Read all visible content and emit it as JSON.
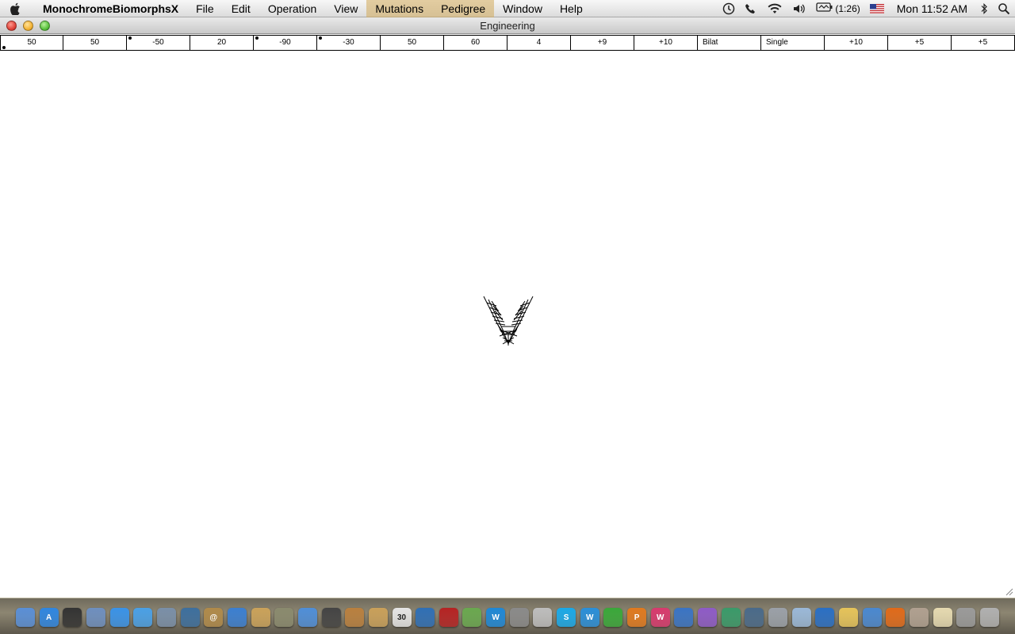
{
  "menubar": {
    "app_name": "MonochromeBiomorphsX",
    "menus": [
      "File",
      "Edit",
      "Operation",
      "View",
      "Mutations",
      "Pedigree",
      "Window",
      "Help"
    ],
    "battery": "(1:26)",
    "clock": "Mon 11:52 AM",
    "status_icons": [
      "time-machine-icon",
      "phone-icon",
      "wifi-icon",
      "volume-icon",
      "battery-icon",
      "us-flag-icon",
      "bluetooth-icon",
      "spotlight-icon"
    ]
  },
  "window": {
    "title": "Engineering"
  },
  "genes": [
    {
      "value": "50",
      "dot": "bottom"
    },
    {
      "value": "50",
      "dot": ""
    },
    {
      "value": "-50",
      "dot": "top"
    },
    {
      "value": "20",
      "dot": ""
    },
    {
      "value": "-90",
      "dot": "top"
    },
    {
      "value": "-30",
      "dot": "top"
    },
    {
      "value": "50",
      "dot": ""
    },
    {
      "value": "60",
      "dot": ""
    },
    {
      "value": "4",
      "dot": ""
    },
    {
      "value": "+9",
      "dot": ""
    },
    {
      "value": "+10",
      "dot": ""
    },
    {
      "value": "Bilat",
      "dot": ""
    },
    {
      "value": "Single",
      "dot": ""
    },
    {
      "value": "+10",
      "dot": ""
    },
    {
      "value": "+5",
      "dot": ""
    },
    {
      "value": "+5",
      "dot": ""
    }
  ],
  "dock": {
    "icons": [
      {
        "name": "finder-icon",
        "color": "#5a8fd6",
        "glyph": ""
      },
      {
        "name": "app-store-icon",
        "color": "#2f86e0",
        "glyph": "A"
      },
      {
        "name": "dashboard-icon",
        "color": "#333333",
        "glyph": ""
      },
      {
        "name": "preview-icon",
        "color": "#6e8fbf",
        "glyph": ""
      },
      {
        "name": "safari-icon",
        "color": "#3a93e8",
        "glyph": ""
      },
      {
        "name": "facetime-icon",
        "color": "#4aa0e6",
        "glyph": ""
      },
      {
        "name": "mail-icon",
        "color": "#7a8fa8",
        "glyph": ""
      },
      {
        "name": "photo-booth-icon",
        "color": "#3d6f9e",
        "glyph": ""
      },
      {
        "name": "address-book-icon",
        "color": "#b08a4a",
        "glyph": "@"
      },
      {
        "name": "itunes-icon",
        "color": "#3b7fd1",
        "glyph": ""
      },
      {
        "name": "iphoto-icon",
        "color": "#caa25a",
        "glyph": ""
      },
      {
        "name": "aperture-icon",
        "color": "#8a8a6e",
        "glyph": ""
      },
      {
        "name": "dvd-player-icon",
        "color": "#4f8ed8",
        "glyph": ""
      },
      {
        "name": "imovie-icon",
        "color": "#444444",
        "glyph": ""
      },
      {
        "name": "garageband-icon",
        "color": "#b9803f",
        "glyph": ""
      },
      {
        "name": "keynote-icon",
        "color": "#c9a05a",
        "glyph": ""
      },
      {
        "name": "calendar-icon",
        "color": "#e5e5e5",
        "glyph": "30"
      },
      {
        "name": "quicktime-icon",
        "color": "#2f6fb5",
        "glyph": ""
      },
      {
        "name": "photo-icon",
        "color": "#b52323",
        "glyph": ""
      },
      {
        "name": "color-wheel-icon",
        "color": "#6aa84f",
        "glyph": ""
      },
      {
        "name": "word-icon",
        "color": "#1e88d6",
        "glyph": "W"
      },
      {
        "name": "system-preferences-icon",
        "color": "#8a8a8a",
        "glyph": ""
      },
      {
        "name": "calculator-icon",
        "color": "#bdbdbd",
        "glyph": ""
      },
      {
        "name": "skype-icon",
        "color": "#1aa9e8",
        "glyph": "S"
      },
      {
        "name": "wunderlist-icon",
        "color": "#2a8fd9",
        "glyph": "W"
      },
      {
        "name": "chart-app-icon",
        "color": "#3aa83a",
        "glyph": ""
      },
      {
        "name": "powerpoint-icon",
        "color": "#e07a1f",
        "glyph": "P"
      },
      {
        "name": "pages-icon",
        "color": "#d83a6e",
        "glyph": "W"
      },
      {
        "name": "camera-icon",
        "color": "#3a74c4",
        "glyph": ""
      },
      {
        "name": "media-icon",
        "color": "#8e5bc7",
        "glyph": ""
      },
      {
        "name": "messenger-icon",
        "color": "#3a9a6a",
        "glyph": ""
      },
      {
        "name": "time-machine-icon",
        "color": "#4a6a8a",
        "glyph": ""
      },
      {
        "name": "scanner-icon",
        "color": "#9aa0a8",
        "glyph": ""
      },
      {
        "name": "lightbulb-icon",
        "color": "#9ab8d8",
        "glyph": ""
      },
      {
        "name": "home-icon",
        "color": "#2a6fc4",
        "glyph": ""
      },
      {
        "name": "notes-icon",
        "color": "#e5c35a",
        "glyph": ""
      },
      {
        "name": "xcode-icon",
        "color": "#4a88d0",
        "glyph": ""
      },
      {
        "name": "firefox-icon",
        "color": "#e06a1a",
        "glyph": ""
      },
      {
        "name": "photos-icon",
        "color": "#b0a090",
        "glyph": ""
      },
      {
        "name": "textedit-icon",
        "color": "#e5d9b0",
        "glyph": ""
      },
      {
        "name": "downloads-icon",
        "color": "#9a9a9a",
        "glyph": ""
      },
      {
        "name": "trash-icon",
        "color": "#b0b0b0",
        "glyph": ""
      }
    ]
  }
}
